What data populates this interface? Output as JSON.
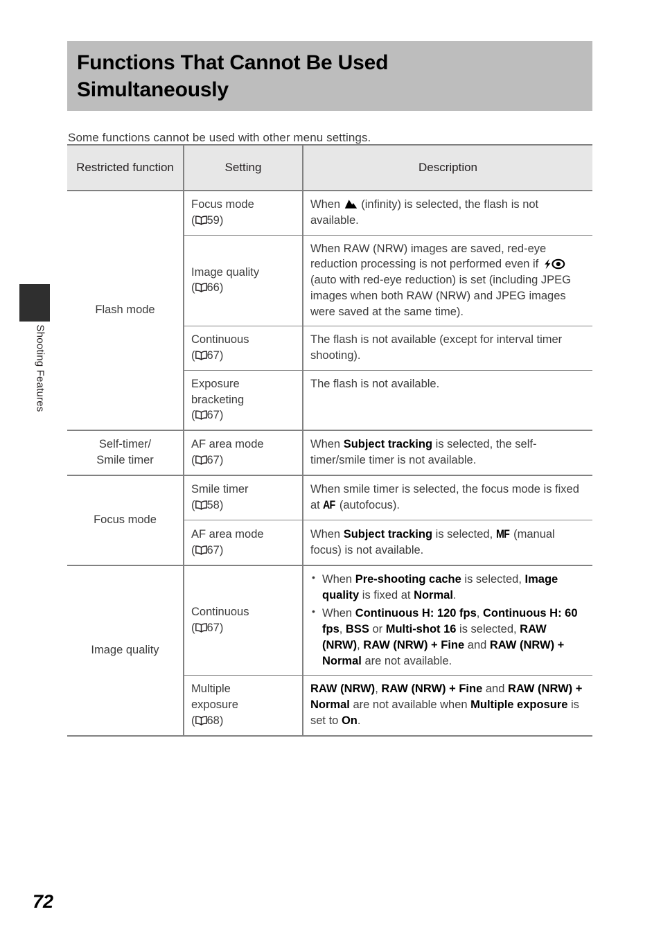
{
  "sidebar": {
    "tab_label": "Shooting Features"
  },
  "header": {
    "title": "Functions That Cannot Be Used Simultaneously"
  },
  "intro": {
    "text": "Some functions cannot be used with other menu settings."
  },
  "page_number": "72",
  "table": {
    "columns": [
      {
        "label": "Restricted function"
      },
      {
        "label": "Setting"
      },
      {
        "label": "Description"
      }
    ],
    "groups": [
      {
        "function": "Flash mode",
        "rows": [
          {
            "setting_name": "Focus mode",
            "setting_ref": "59",
            "setting_ref_icon": "book-icon",
            "description_plain": "When ▲ (infinity) is selected, the flash is not available."
          },
          {
            "setting_name": "Image quality",
            "setting_ref": "66",
            "setting_ref_icon": "book-icon",
            "description_plain": "When RAW (NRW) images are saved, red-eye reduction processing is not performed even if ⚡◉ (auto with red-eye reduction) is set (including JPEG images when both RAW (NRW) and JPEG images were saved at the same time)."
          },
          {
            "setting_name": "Continuous",
            "setting_ref": "67",
            "setting_ref_icon": "book-icon",
            "description_plain": "The flash is not available (except for interval timer shooting)."
          },
          {
            "setting_name": "Exposure bracketing",
            "setting_ref": "67",
            "setting_ref_icon": "book-icon",
            "description_plain": "The flash is not available."
          }
        ]
      },
      {
        "function": "Self-timer/ Smile timer",
        "rows": [
          {
            "setting_name": "AF area mode",
            "setting_ref": "67",
            "setting_ref_icon": "book-icon",
            "description_plain": "When Subject tracking is selected, the self-timer/smile timer is not available."
          }
        ]
      },
      {
        "function": "Focus mode",
        "rows": [
          {
            "setting_name": "Smile timer",
            "setting_ref": "58",
            "setting_ref_icon": "book-icon",
            "description_plain": "When smile timer is selected, the focus mode is fixed at AF (autofocus)."
          },
          {
            "setting_name": "AF area mode",
            "setting_ref": "67",
            "setting_ref_icon": "book-icon",
            "description_plain": "When Subject tracking is selected, MF (manual focus) is not available."
          }
        ]
      },
      {
        "function": "Image quality",
        "rows": [
          {
            "setting_name": "Continuous",
            "setting_ref": "67",
            "setting_ref_icon": "book-icon",
            "description_bullets": [
              "When Pre-shooting cache is selected, Image quality is fixed at Normal.",
              "When Continuous H: 120 fps, Continuous H: 60 fps, BSS or Multi-shot 16 is selected, RAW (NRW), RAW (NRW) + Fine and RAW (NRW) + Normal are not available."
            ]
          },
          {
            "setting_name": "Multiple exposure",
            "setting_ref": "68",
            "setting_ref_icon": "book-icon",
            "description_plain": "RAW (NRW), RAW (NRW) + Fine and RAW (NRW) + Normal are not available when Multiple exposure is set to On."
          }
        ]
      }
    ]
  },
  "text_fragments": {
    "when": "When ",
    "infinity_suffix": " (infinity) is selected, the flash is not available.",
    "iq_a": "When RAW (NRW) images are saved, red-eye reduction processing is not performed even if ",
    "iq_b": " (auto with red-eye reduction) is set (including JPEG images when both RAW (NRW) and JPEG images were saved at the same time).",
    "cont_flash": "The flash is not available (except for interval timer shooting).",
    "flash_na": "The flash is not available.",
    "st_a": "When ",
    "st_bold": "Subject tracking",
    "st_b": " is selected, the self-timer/smile timer is not available.",
    "sm_a": "When smile timer is selected, the focus mode is fixed at ",
    "sm_af": "AF",
    "sm_b": " (autofocus).",
    "fm_a": "When ",
    "fm_bold": "Subject tracking",
    "fm_mid": " is selected, ",
    "fm_mf": "MF",
    "fm_b": " (manual focus) is not available.",
    "b1_a": "When ",
    "b1_bold1": "Pre-shooting cache",
    "b1_mid": " is selected, ",
    "b1_bold2": "Image quality",
    "b1_mid2": " is fixed at ",
    "b1_bold3": "Normal",
    "b1_end": ".",
    "b2_a": "When ",
    "b2_bold1": "Continuous H: 120 fps",
    "b2_c1": ", ",
    "b2_bold2": "Continuous H: 60 fps",
    "b2_c2": ", ",
    "b2_bold3": "BSS",
    "b2_or": " or ",
    "b2_bold4": "Multi-shot 16",
    "b2_mid": " is selected, ",
    "b2_bold5": "RAW (NRW)",
    "b2_c3": ", ",
    "b2_bold6": "RAW (NRW) + Fine",
    "b2_and": " and ",
    "b2_bold7": "RAW (NRW) + Normal",
    "b2_end": " are not available.",
    "me_bold1": "RAW (NRW)",
    "me_c1": ", ",
    "me_bold2": "RAW (NRW) + Fine",
    "me_and": " and ",
    "me_bold3": "RAW (NRW) + Normal",
    "me_mid": " are not available when ",
    "me_bold4": "Multiple exposure",
    "me_mid2": " is set to ",
    "me_bold5": "On",
    "me_end": "."
  }
}
